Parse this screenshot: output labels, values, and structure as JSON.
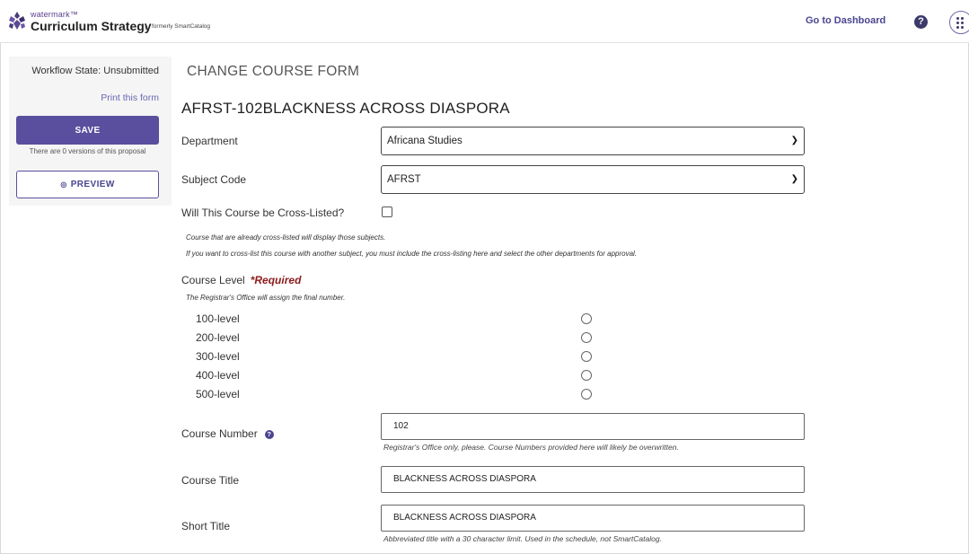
{
  "header": {
    "brand_small": "watermark™",
    "brand_main": "Curriculum Strategy",
    "brand_separator": "|",
    "brand_formerly": "formerly SmartCatalog",
    "go_dashboard": "Go to Dashboard",
    "help_icon": "?"
  },
  "sidebar": {
    "workflow_state": "Workflow State: Unsubmitted",
    "print_link": "Print this form",
    "save_label": "SAVE",
    "versions_text": "There are 0 versions of this proposal",
    "preview_label": "PREVIEW",
    "preview_icon": "◎"
  },
  "main": {
    "form_heading": "CHANGE COURSE FORM",
    "course_heading": "AFRST-102BLACKNESS ACROSS DIASPORA",
    "department": {
      "label": "Department",
      "value": "Africana Studies"
    },
    "subject_code": {
      "label": "Subject Code",
      "value": "AFRST"
    },
    "cross_listed": {
      "label": "Will This Course be Cross-Listed?",
      "checked": false,
      "note1": "Course that are already cross-listed will display those subjects.",
      "note2": "If you want to cross-list this course with another subject, you must include the cross-listing here and select the other departments for approval."
    },
    "course_level": {
      "label": "Course Level",
      "required": "*Required",
      "note": "The Registrar's Office will assign the final number.",
      "options": [
        "100-level",
        "200-level",
        "300-level",
        "400-level",
        "500-level"
      ]
    },
    "course_number": {
      "label": "Course Number",
      "help_icon": "?",
      "value": "102",
      "hint": "Registrar's Office only, please. Course Numbers provided here will likely be overwritten."
    },
    "course_title": {
      "label": "Course Title",
      "value": "BLACKNESS ACROSS DIASPORA"
    },
    "short_title": {
      "label": "Short Title",
      "value": "BLACKNESS ACROSS DIASPORA",
      "hint": "Abbreviated title with a 30 character limit. Used in the schedule, not SmartCatalog."
    }
  },
  "colors": {
    "brand_purple": "#5a4f9e",
    "link_purple": "#4a4590",
    "required_red": "#8b1c1c"
  },
  "icons": [
    "watermark-logo-icon",
    "help-icon",
    "apps-grid-icon",
    "eye-icon",
    "chevron-down-icon",
    "question-icon"
  ]
}
